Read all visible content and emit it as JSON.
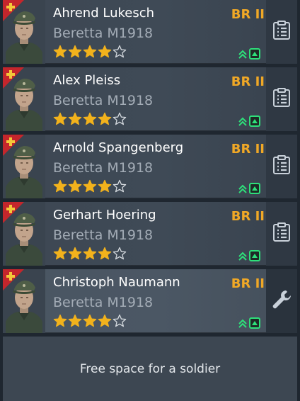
{
  "soldiers": [
    {
      "name": "Ahrend Lukesch",
      "weapon": "Beretta M1918",
      "br": "BR II",
      "stars_filled": 4,
      "stars_total": 5,
      "side_action_icon": "clipboard-list-icon"
    },
    {
      "name": "Alex Pleiss",
      "weapon": "Beretta M1918",
      "br": "BR II",
      "stars_filled": 4,
      "stars_total": 5,
      "side_action_icon": "clipboard-list-icon"
    },
    {
      "name": "Arnold Spangenberg",
      "weapon": "Beretta M1918",
      "br": "BR II",
      "stars_filled": 4,
      "stars_total": 5,
      "side_action_icon": "clipboard-list-icon"
    },
    {
      "name": "Gerhart Hoering",
      "weapon": "Beretta M1918",
      "br": "BR II",
      "stars_filled": 4,
      "stars_total": 5,
      "side_action_icon": "clipboard-list-icon"
    },
    {
      "name": "Christoph Naumann",
      "weapon": "Beretta M1918",
      "br": "BR II",
      "stars_filled": 4,
      "stars_total": 5,
      "side_action_icon": "wrench-icon"
    }
  ],
  "free_slot": {
    "label": "Free space for a soldier"
  },
  "colors": {
    "br_text": "#f0a826",
    "star_fill": "#f2b21c",
    "upgrade_green": "#2ee07a",
    "rank_badge_red": "#c4262c",
    "rank_badge_cross": "#f3c83a"
  },
  "icons": {
    "rank_badge": "rank-cross-badge-icon",
    "upgrade": "chevron-up-double-icon",
    "upgrade_box": "upgrade-box-icon",
    "star": "star-icon"
  }
}
